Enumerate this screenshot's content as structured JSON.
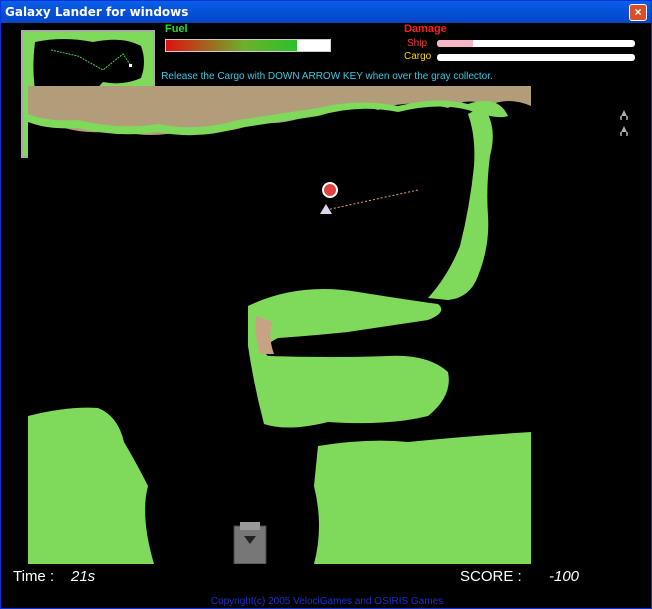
{
  "window": {
    "title": "Galaxy Lander for windows",
    "close_label": "×"
  },
  "hud": {
    "fuel_label": "Fuel",
    "fuel_level": 0.8,
    "damage_label": "Damage",
    "ship_label": "Ship",
    "ship_damage": 0.18,
    "cargo_label": "Cargo",
    "cargo_damage": 0.0,
    "hint": "Release the Cargo with DOWN ARROW KEY when over the gray collector."
  },
  "status": {
    "time_label": "Time :",
    "time_value": "21s",
    "score_label": "SCORE :",
    "score_value": "-100"
  },
  "footer": {
    "copyright": "Copyright(c) 2005 VelociGames and OSIRIS Games"
  },
  "lives": {
    "count": 2,
    "icon": "lander-icon"
  },
  "colors": {
    "ground": "#7fd95a",
    "sand": "#b19d7a",
    "space": "#000000"
  }
}
